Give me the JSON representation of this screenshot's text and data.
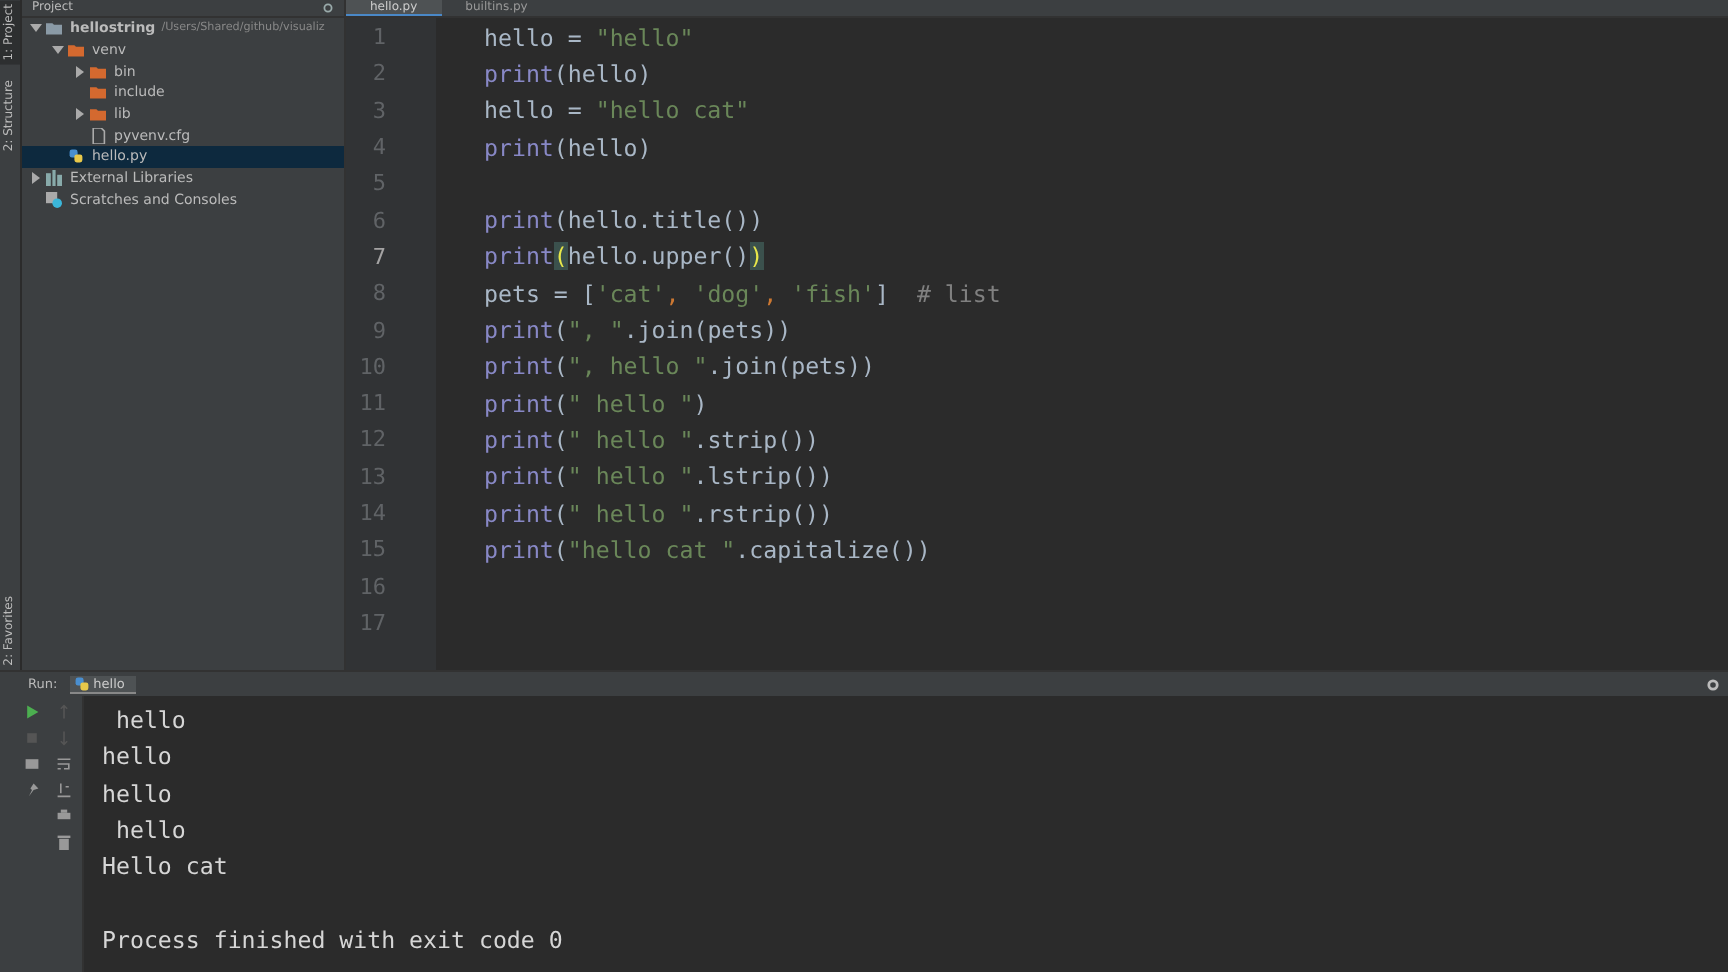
{
  "side_strip": {
    "top": [
      {
        "label": "1: Project",
        "selected": true
      },
      {
        "label": "2: Structure",
        "selected": false
      }
    ],
    "bottom": [
      {
        "label": "2: Favorites",
        "selected": false
      }
    ]
  },
  "project_panel": {
    "title": "Project",
    "tree": [
      {
        "name": "hellostring",
        "path": "/Users/Shared/github/visualiz",
        "kind": "folder",
        "expanded": true,
        "selected": false,
        "children": [
          {
            "name": "venv",
            "kind": "folder",
            "expanded": true,
            "selected": false,
            "children": [
              {
                "name": "bin",
                "kind": "folder",
                "expanded": false,
                "selected": false
              },
              {
                "name": "include",
                "kind": "folder",
                "selected": false
              },
              {
                "name": "lib",
                "kind": "folder",
                "expanded": false,
                "selected": false
              },
              {
                "name": "pyvenv.cfg",
                "kind": "file",
                "selected": false
              }
            ]
          },
          {
            "name": "hello.py",
            "kind": "python",
            "selected": true
          }
        ]
      },
      {
        "name": "External Libraries",
        "kind": "library",
        "expanded": false,
        "selected": false
      },
      {
        "name": "Scratches and Consoles",
        "kind": "scratch",
        "selected": false
      }
    ]
  },
  "editor": {
    "tabs": [
      {
        "label": "hello.py",
        "selected": true
      },
      {
        "label": "builtins.py",
        "selected": false
      }
    ],
    "lines": [
      {
        "number": "1",
        "current": false,
        "tokens": [
          {
            "text": "hello = ",
            "kind": "plain"
          },
          {
            "text": "\"hello\"",
            "kind": "str"
          }
        ]
      },
      {
        "number": "2",
        "current": false,
        "tokens": [
          {
            "text": "print",
            "kind": "kw"
          },
          {
            "text": "(hello)",
            "kind": "plain"
          }
        ]
      },
      {
        "number": "3",
        "current": false,
        "tokens": [
          {
            "text": "hello = ",
            "kind": "plain"
          },
          {
            "text": "\"hello cat\"",
            "kind": "str"
          }
        ]
      },
      {
        "number": "4",
        "current": false,
        "tokens": [
          {
            "text": "print",
            "kind": "kw"
          },
          {
            "text": "(hello)",
            "kind": "plain"
          }
        ]
      },
      {
        "number": "5",
        "current": false
      },
      {
        "number": "6",
        "current": false,
        "tokens": [
          {
            "text": "print",
            "kind": "kw"
          },
          {
            "text": "(hello.title())",
            "kind": "plain"
          }
        ]
      },
      {
        "number": "7",
        "current": true,
        "tokens": [
          {
            "text": "print",
            "kind": "kw"
          },
          {
            "text": "(",
            "kind": "match"
          },
          {
            "text": "hello.upper()",
            "kind": "plain"
          },
          {
            "text": ")",
            "kind": "match"
          }
        ]
      },
      {
        "number": "8",
        "current": false,
        "tokens": [
          {
            "text": "pets = [",
            "kind": "plain"
          },
          {
            "text": "'cat'",
            "kind": "str"
          },
          {
            "text": ", ",
            "kind": "sep"
          },
          {
            "text": "'dog'",
            "kind": "str"
          },
          {
            "text": ", ",
            "kind": "sep"
          },
          {
            "text": "'fish'",
            "kind": "str"
          },
          {
            "text": "]  ",
            "kind": "plain"
          },
          {
            "text": "# list",
            "kind": "comment"
          }
        ]
      },
      {
        "number": "9",
        "current": false,
        "tokens": [
          {
            "text": "print",
            "kind": "kw"
          },
          {
            "text": "(",
            "kind": "plain"
          },
          {
            "text": "\", \"",
            "kind": "str"
          },
          {
            "text": ".join(pets))",
            "kind": "plain"
          }
        ]
      },
      {
        "number": "10",
        "current": false,
        "tokens": [
          {
            "text": "print",
            "kind": "kw"
          },
          {
            "text": "(",
            "kind": "plain"
          },
          {
            "text": "\", hello \"",
            "kind": "str"
          },
          {
            "text": ".join(pets))",
            "kind": "plain"
          }
        ]
      },
      {
        "number": "11",
        "current": false,
        "tokens": [
          {
            "text": "print",
            "kind": "kw"
          },
          {
            "text": "(",
            "kind": "plain"
          },
          {
            "text": "\" hello \"",
            "kind": "str"
          },
          {
            "text": ")",
            "kind": "plain"
          }
        ]
      },
      {
        "number": "12",
        "current": false,
        "tokens": [
          {
            "text": "print",
            "kind": "kw"
          },
          {
            "text": "(",
            "kind": "plain"
          },
          {
            "text": "\" hello \"",
            "kind": "str"
          },
          {
            "text": ".strip())",
            "kind": "plain"
          }
        ]
      },
      {
        "number": "13",
        "current": false,
        "tokens": [
          {
            "text": "print",
            "kind": "kw"
          },
          {
            "text": "(",
            "kind": "plain"
          },
          {
            "text": "\" hello \"",
            "kind": "str"
          },
          {
            "text": ".lstrip())",
            "kind": "plain"
          }
        ]
      },
      {
        "number": "14",
        "current": false,
        "tokens": [
          {
            "text": "print",
            "kind": "kw"
          },
          {
            "text": "(",
            "kind": "plain"
          },
          {
            "text": "\" hello \"",
            "kind": "str"
          },
          {
            "text": ".rstrip())",
            "kind": "plain"
          }
        ]
      },
      {
        "number": "15",
        "current": false,
        "tokens": [
          {
            "text": "print",
            "kind": "kw"
          },
          {
            "text": "(",
            "kind": "plain"
          },
          {
            "text": "\"hello cat \"",
            "kind": "str"
          },
          {
            "text": ".capitalize())",
            "kind": "plain"
          }
        ]
      },
      {
        "number": "16",
        "current": false
      },
      {
        "number": "17",
        "current": false
      }
    ]
  },
  "run_panel": {
    "label": "Run:",
    "tabs": [
      {
        "label": "hello",
        "selected": true
      }
    ],
    "output": [
      " hello",
      "hello",
      "hello",
      " hello",
      "Hello cat"
    ],
    "exit_message": "Process finished with exit code 0"
  }
}
